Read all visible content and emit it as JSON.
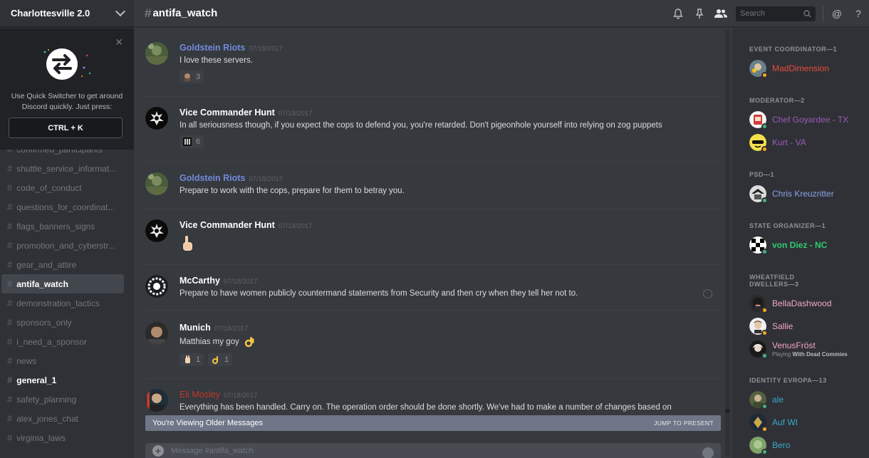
{
  "server": {
    "name": "Charlottesville 2.0"
  },
  "quick_switcher": {
    "text_line1": "Use Quick Switcher to get around",
    "text_line2": "Discord quickly. Just press:",
    "shortcut": "CTRL + K",
    "close_icon": "close-icon"
  },
  "channels": [
    {
      "name": "confirmed_participants",
      "state": "normal"
    },
    {
      "name": "shuttle_service_informat...",
      "state": "normal"
    },
    {
      "name": "code_of_conduct",
      "state": "normal"
    },
    {
      "name": "questions_for_coordinat...",
      "state": "normal"
    },
    {
      "name": "flags_banners_signs",
      "state": "normal"
    },
    {
      "name": "promotion_and_cyberstr...",
      "state": "normal"
    },
    {
      "name": "gear_and_attire",
      "state": "normal"
    },
    {
      "name": "antifa_watch",
      "state": "active"
    },
    {
      "name": "demonstration_tactics",
      "state": "normal"
    },
    {
      "name": "sponsors_only",
      "state": "normal"
    },
    {
      "name": "i_need_a_sponsor",
      "state": "normal"
    },
    {
      "name": "news",
      "state": "normal"
    },
    {
      "name": "general_1",
      "state": "unread"
    },
    {
      "name": "safety_planning",
      "state": "normal"
    },
    {
      "name": "alex_jones_chat",
      "state": "normal"
    },
    {
      "name": "virginia_laws",
      "state": "normal"
    }
  ],
  "header": {
    "hash": "#",
    "channel_name": "antifa_watch",
    "search_placeholder": "Search",
    "icons": [
      "bell-icon",
      "pin-icon",
      "members-icon",
      "search-icon",
      "mention-icon",
      "help-icon"
    ],
    "mention": "@",
    "help": "?"
  },
  "messages": [
    {
      "author": "Goldstein Riots",
      "author_color": "#7289da",
      "timestamp": "07/18/2017",
      "text": "I love these servers.",
      "reactions": [
        {
          "count": "3"
        }
      ]
    },
    {
      "author": "Vice Commander Hunt",
      "author_color": "#ffffff",
      "timestamp": "07/18/2017",
      "text": "In all seriousness though, if you expect the cops to defend you, you're retarded. Don't pigeonhole yourself into relying on zog puppets",
      "reactions": [
        {
          "count": "6"
        }
      ]
    },
    {
      "author": "Goldstein Riots",
      "author_color": "#7289da",
      "timestamp": "07/18/2017",
      "text": "Prepare to work with the cops, prepare for them to betray you.",
      "reactions": []
    },
    {
      "author": "Vice Commander Hunt",
      "author_color": "#ffffff",
      "timestamp": "07/18/2017",
      "text": "",
      "reactions": []
    },
    {
      "author": "McCarthy",
      "author_color": "#ffffff",
      "timestamp": "07/18/2017",
      "text": "Prepare to have women publicly countermand statements from Security and then cry when they tell her not to.",
      "reactions": []
    },
    {
      "author": "Munich",
      "author_color": "#ffffff",
      "timestamp": "07/18/2017",
      "text": "Matthias my goy",
      "reactions": [
        {
          "count": "1"
        },
        {
          "count": "1"
        }
      ]
    },
    {
      "author": "Eli Mosley",
      "author_color": "#c0392b",
      "timestamp": "07/18/2017",
      "text": "Everything has been handled. Carry on. The operation order should be done shortly. We've had to make a number of changes based on",
      "reactions": []
    }
  ],
  "older_bar": {
    "text": "You're Viewing Older Messages",
    "jump": "JUMP TO PRESENT"
  },
  "input": {
    "placeholder": "Message #antifa_watch"
  },
  "member_groups": [
    {
      "role": "EVENT COORDINATOR—1",
      "members": [
        {
          "name": "MadDimension",
          "color": "#e74c3c",
          "status": "#faa61a"
        }
      ]
    },
    {
      "role": "MODERATOR—2",
      "members": [
        {
          "name": "Chef Goyardee - TX",
          "color": "#9b59b6",
          "status": "#43b581"
        },
        {
          "name": "Kurt - VA",
          "color": "#9b59b6",
          "status": "#faa61a"
        }
      ]
    },
    {
      "role": "PSD—1",
      "members": [
        {
          "name": "Chris Kreuzritter",
          "color": "#8aa4e6",
          "status": "#43b581"
        }
      ]
    },
    {
      "role": "STATE ORGANIZER—1",
      "members": [
        {
          "name": "von Diez - NC",
          "color": "#2ecc71",
          "status": "#43b581"
        }
      ]
    },
    {
      "role": "WHEATFIELD",
      "role_line2": "DWELLERS—3",
      "members": [
        {
          "name": "BellaDashwood",
          "color": "#f3a6c8",
          "status": "#faa61a"
        },
        {
          "name": "Sallie",
          "color": "#f3a6c8",
          "status": "#faa61a"
        },
        {
          "name": "VenusFröst",
          "color": "#f3a6c8",
          "status": "#43b581",
          "activity_prefix": "Playing ",
          "activity": "With Dead Commies"
        }
      ]
    },
    {
      "role": "IDENTITY EVROPA—13",
      "members": [
        {
          "name": "ale",
          "color": "#3ba9c9",
          "status": "#43b581"
        },
        {
          "name": "Auf WI",
          "color": "#3ba9c9",
          "status": "#faa61a"
        },
        {
          "name": "Bero",
          "color": "#3ba9c9",
          "status": "#43b581"
        }
      ]
    }
  ]
}
